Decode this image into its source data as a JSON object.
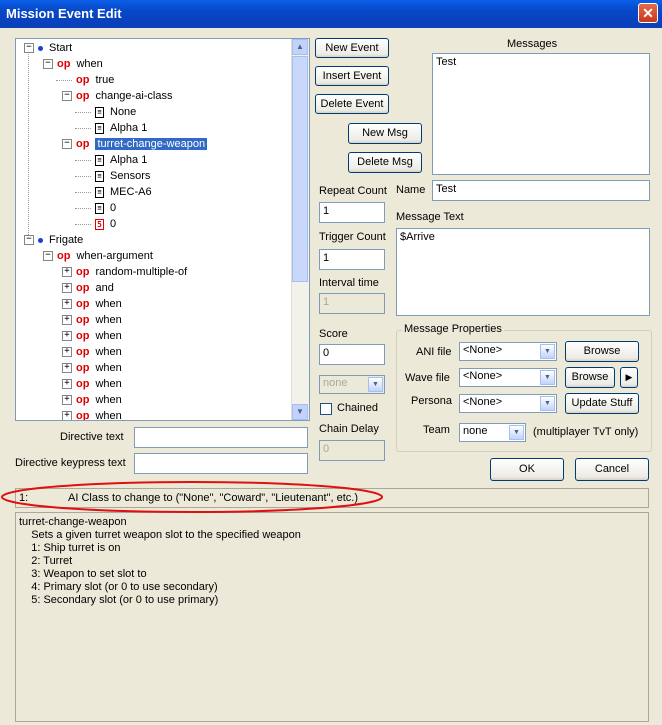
{
  "window": {
    "title": "Mission Event Edit",
    "close_glyph": "✕"
  },
  "tree": {
    "nodes": [
      {
        "label": "Start",
        "kind": "root"
      },
      {
        "label": "when",
        "kind": "op"
      },
      {
        "label": "true",
        "kind": "op"
      },
      {
        "label": "change-ai-class",
        "kind": "op"
      },
      {
        "label": "None",
        "kind": "doc"
      },
      {
        "label": "Alpha 1",
        "kind": "doc"
      },
      {
        "label": "turret-change-weapon",
        "kind": "op",
        "selected": true
      },
      {
        "label": "Alpha 1",
        "kind": "doc"
      },
      {
        "label": "Sensors",
        "kind": "doc"
      },
      {
        "label": "MEC-A6",
        "kind": "doc"
      },
      {
        "label": "0",
        "kind": "doc"
      },
      {
        "label": "0",
        "kind": "doc5",
        "icon_text": "5"
      },
      {
        "label": "Frigate",
        "kind": "root"
      },
      {
        "label": "when-argument",
        "kind": "op"
      },
      {
        "label": "random-multiple-of",
        "kind": "op"
      },
      {
        "label": "and",
        "kind": "op"
      },
      {
        "label": "when",
        "kind": "op"
      },
      {
        "label": "when",
        "kind": "op"
      },
      {
        "label": "when",
        "kind": "op"
      },
      {
        "label": "when",
        "kind": "op"
      },
      {
        "label": "when",
        "kind": "op"
      },
      {
        "label": "when",
        "kind": "op"
      },
      {
        "label": "when",
        "kind": "op"
      },
      {
        "label": "when",
        "kind": "op"
      }
    ],
    "op_glyph": "op"
  },
  "buttons": {
    "new_event": "New Event",
    "insert_event": "Insert Event",
    "delete_event": "Delete Event",
    "new_msg": "New Msg",
    "delete_msg": "Delete Msg",
    "browse1": "Browse",
    "browse2": "Browse",
    "play": "▶",
    "update_stuff": "Update Stuff",
    "ok": "OK",
    "cancel": "Cancel"
  },
  "messages": {
    "label": "Messages",
    "items": [
      "Test"
    ]
  },
  "fields": {
    "repeat_count_label": "Repeat Count",
    "repeat_count": "1",
    "trigger_count_label": "Trigger Count",
    "trigger_count": "1",
    "interval_time_label": "Interval time",
    "interval_time": "1",
    "score_label": "Score",
    "score": "0",
    "team_select": "none",
    "chained_label": "Chained",
    "chain_delay_label": "Chain Delay",
    "chain_delay": "0",
    "name_label": "Name",
    "name": "Test",
    "message_text_label": "Message Text",
    "message_text": "$Arrive",
    "directive_text_label": "Directive text",
    "directive_text": "",
    "directive_keypress_label": "Directive keypress text",
    "directive_keypress": ""
  },
  "message_properties": {
    "title": "Message Properties",
    "ani_label": "ANI file",
    "ani_value": "<None>",
    "wave_label": "Wave file",
    "wave_value": "<None>",
    "persona_label": "Persona",
    "persona_value": "<None>",
    "team_label": "Team",
    "team_value": "none",
    "team_note": "(multiplayer TvT only)"
  },
  "status": {
    "index": "1:",
    "text": "AI Class to change to (\"None\", \"Coward\", \"Lieutenant\", etc.)"
  },
  "help_text": "turret-change-weapon\n    Sets a given turret weapon slot to the specified weapon\n    1: Ship turret is on\n    2: Turret\n    3: Weapon to set slot to\n    4: Primary slot (or 0 to use secondary)\n    5: Secondary slot (or 0 to use primary)",
  "annotation_color": "#e01010"
}
